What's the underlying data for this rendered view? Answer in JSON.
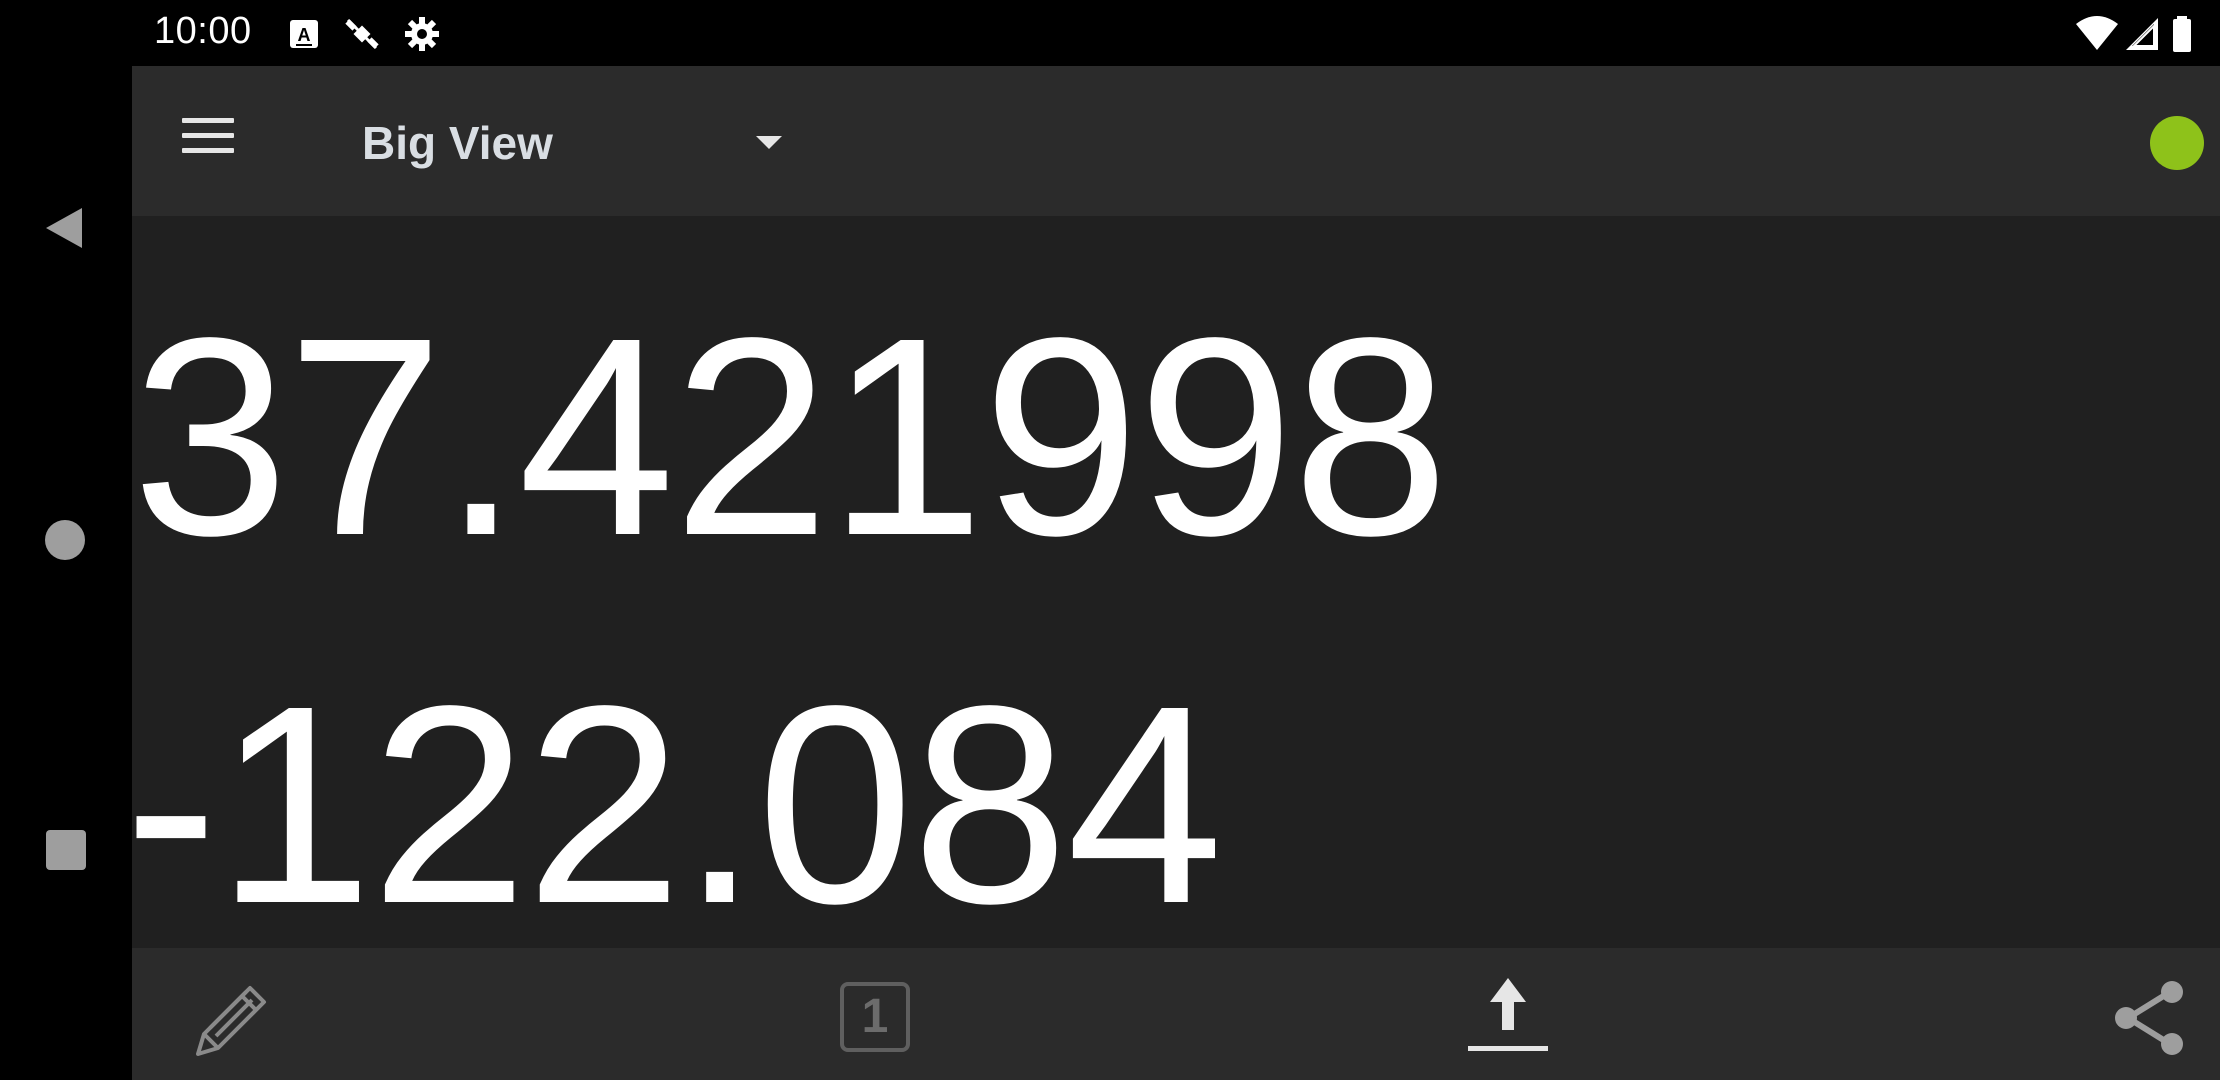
{
  "status_bar": {
    "time": "10:00",
    "left_icons": [
      "keyboard-a-icon",
      "satellite-off-icon",
      "settings-gear-icon"
    ],
    "right_icons": [
      "wifi-icon",
      "cell-signal-icon",
      "battery-icon"
    ]
  },
  "nav_bar": {
    "buttons": [
      "back-icon",
      "home-icon",
      "recents-icon"
    ]
  },
  "toolbar": {
    "menu_icon": "hamburger-menu-icon",
    "view_selector": {
      "selected": "Big View"
    },
    "gps_status_color": "#8ec21a"
  },
  "coordinates": {
    "latitude": "37.421998",
    "longitude": "-122.084"
  },
  "bottom_bar": {
    "edit_icon": "pencil-icon",
    "counter_value": "1",
    "upload_icon": "upload-icon",
    "share_icon": "share-icon"
  },
  "colors": {
    "background": "#202020",
    "toolbar": "#2b2b2b",
    "accent_green": "#8ec21a"
  }
}
